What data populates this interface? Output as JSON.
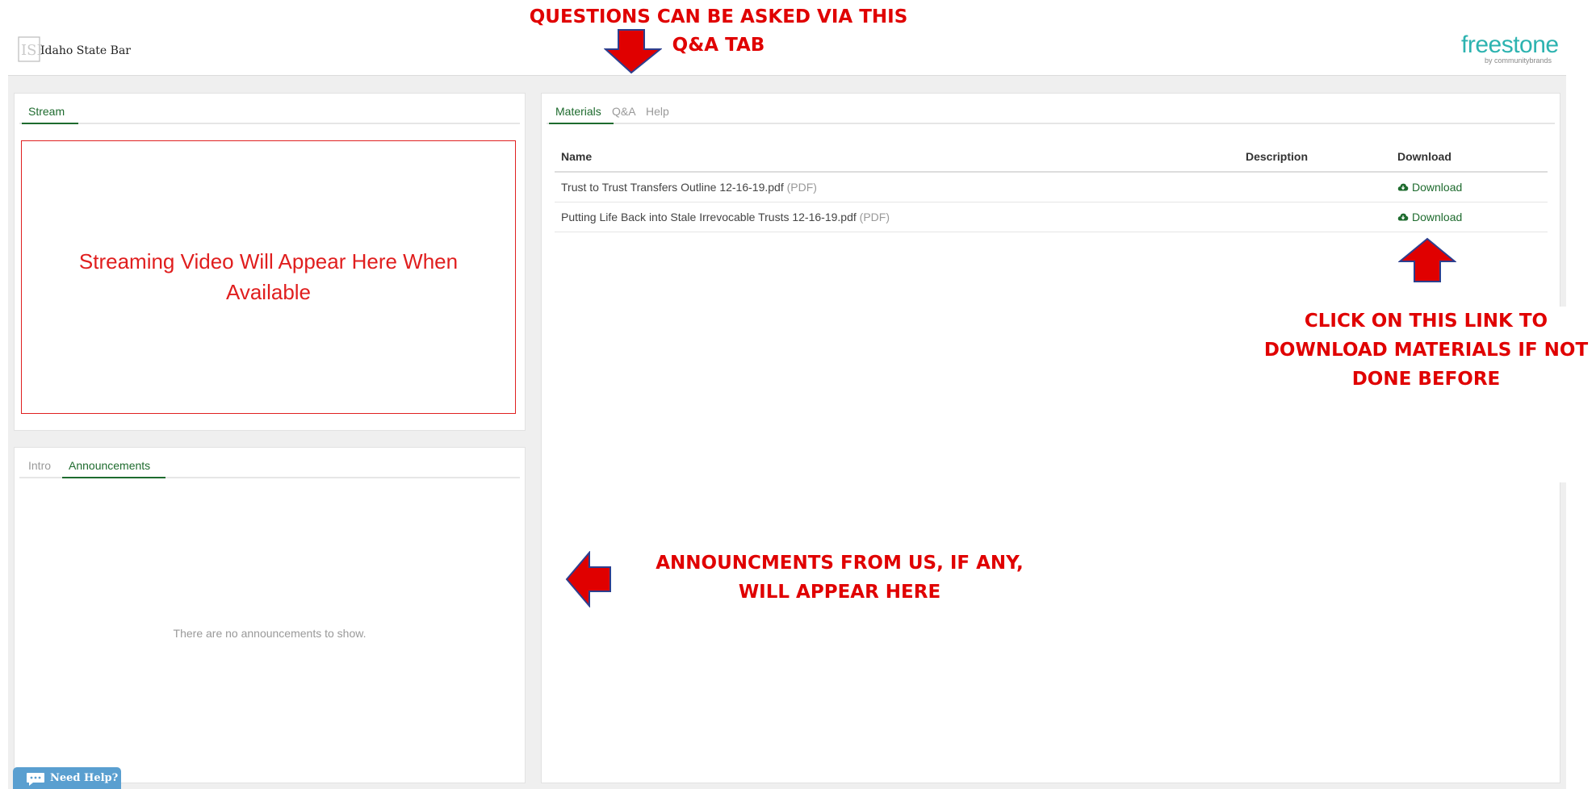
{
  "header": {
    "org_name": "Idaho State Bar",
    "brand": {
      "name": "freestone",
      "byline": "by communitybrands"
    }
  },
  "stream_panel": {
    "tab": "Stream",
    "placeholder": "Streaming Video Will Appear Here When Available"
  },
  "info_panel": {
    "tabs": [
      "Intro",
      "Announcements"
    ],
    "active_tab": "Announcements",
    "empty_message": "There are no announcements to show."
  },
  "materials_panel": {
    "tabs": [
      "Materials",
      "Q&A",
      "Help"
    ],
    "active_tab": "Materials",
    "columns": [
      "Name",
      "Description",
      "Download"
    ],
    "rows": [
      {
        "name": "Trust to Trust Transfers Outline 12-16-19.pdf",
        "type": "(PDF)",
        "description": "",
        "download": "Download"
      },
      {
        "name": "Putting Life Back into Stale Irrevocable Trusts 12-16-19.pdf",
        "type": "(PDF)",
        "description": "",
        "download": "Download"
      }
    ]
  },
  "annotations": {
    "qa_tab": [
      "QUESTIONS CAN BE ASKED VIA THIS",
      "Q&A TAB"
    ],
    "download_link": [
      "CLICK ON THIS LINK TO",
      "DOWNLOAD MATERIALS IF NOT",
      "DONE BEFORE"
    ],
    "announcements": [
      "ANNOUNCMENTS FROM US, IF ANY,",
      "WILL APPEAR HERE"
    ]
  },
  "help_button": {
    "label": "Need Help?"
  },
  "colors": {
    "accent": "#1e6b2e",
    "annotation": "#e00000",
    "brand": "#2db3b0",
    "help": "#5a9fd0"
  }
}
